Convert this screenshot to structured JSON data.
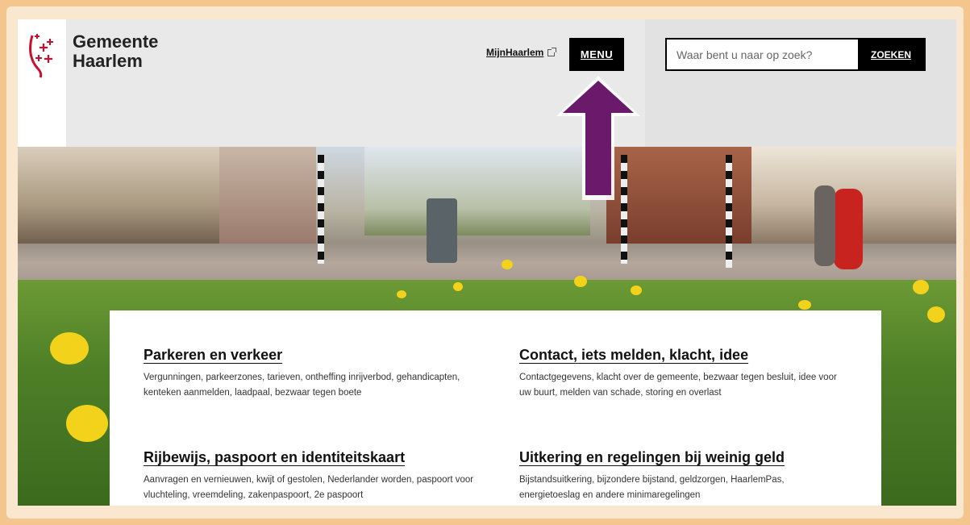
{
  "header": {
    "logo_line1": "Gemeente",
    "logo_line2": "Haarlem",
    "mijn_link": "MijnHaarlem",
    "menu_label": "MENU",
    "search_placeholder": "Waar bent u naar op zoek?",
    "search_button": "ZOEKEN"
  },
  "colors": {
    "arrow": "#6b1a6b",
    "frame": "#f5c58e",
    "header_bg": "#e9e9e9",
    "logo_red": "#c8102e"
  },
  "items": [
    {
      "title": "Parkeren en verkeer",
      "desc": "Vergunningen, parkeerzones, tarieven, ontheffing inrijverbod, gehandicapten, kenteken aanmelden, laadpaal, bezwaar tegen boete"
    },
    {
      "title": "Contact, iets melden, klacht, idee",
      "desc": "Contactgegevens, klacht over de gemeente, bezwaar tegen besluit, idee voor uw buurt, melden van schade, storing en overlast"
    },
    {
      "title": "Rijbewijs, paspoort en identiteitskaart",
      "desc": "Aanvragen en vernieuwen, kwijt of gestolen, Nederlander worden, paspoort voor vluchteling, vreemdeling, zakenpaspoort, 2e paspoort"
    },
    {
      "title": "Uitkering en regelingen bij weinig geld",
      "desc": "Bijstandsuitkering, bijzondere bijstand, geldzorgen, HaarlemPas, energietoeslag en andere minimaregelingen"
    }
  ]
}
